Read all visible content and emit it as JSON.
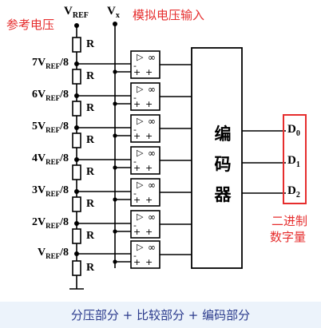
{
  "annotations": {
    "reference_voltage": "参考电压",
    "analog_input": "模拟电压输入",
    "binary_digital_line1": "二进制",
    "binary_digital_line2": "数字量"
  },
  "inputs": {
    "vref_main": "V",
    "vref_sub": "REF",
    "vx_main": "V",
    "vx_sub": "x"
  },
  "resistor_label": "R",
  "taps": [
    {
      "coef": "7",
      "main": "V",
      "sub": "REF",
      "tail": "/8"
    },
    {
      "coef": "6",
      "main": "V",
      "sub": "REF",
      "tail": "/8"
    },
    {
      "coef": "5",
      "main": "V",
      "sub": "REF",
      "tail": "/8"
    },
    {
      "coef": "4",
      "main": "V",
      "sub": "REF",
      "tail": "/8"
    },
    {
      "coef": "3",
      "main": "V",
      "sub": "REF",
      "tail": "/8"
    },
    {
      "coef": "2",
      "main": "V",
      "sub": "REF",
      "tail": "/8"
    },
    {
      "coef": "",
      "main": "V",
      "sub": "REF",
      "tail": "/8"
    }
  ],
  "comparator": {
    "triangle": "▷",
    "gain": "∞",
    "minus": "-",
    "plus": "+"
  },
  "encoder": {
    "chars": [
      "编",
      "码",
      "器"
    ]
  },
  "outputs": [
    {
      "main": "D",
      "sub": "0"
    },
    {
      "main": "D",
      "sub": "1"
    },
    {
      "main": "D",
      "sub": "2"
    }
  ],
  "caption": "分压部分 + 比较部分 + 编码部分",
  "colors": {
    "annotation": "#e62d2d",
    "caption_text": "#2a3a8c",
    "caption_bg": "#ecf3fb",
    "line": "#000000"
  }
}
